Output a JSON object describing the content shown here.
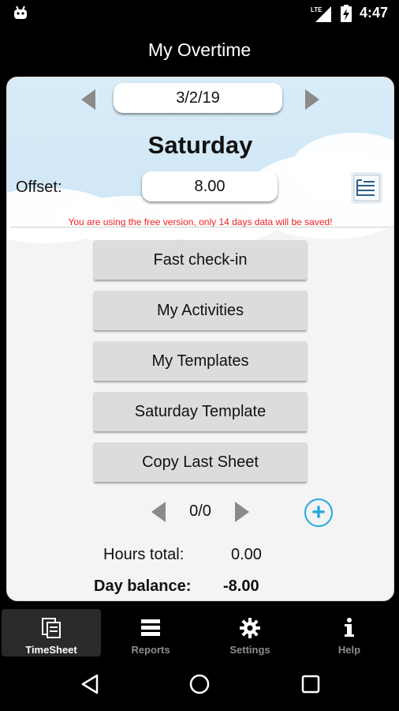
{
  "status_bar": {
    "time": "4:47",
    "network": "LTE"
  },
  "app_title": "My Overtime",
  "date": "3/2/19",
  "day_name": "Saturday",
  "offset": {
    "label": "Offset:",
    "value": "8.00"
  },
  "notice": "You are using the free version, only 14 days data will be saved!",
  "actions": [
    "Fast check-in",
    "My Activities",
    "My Templates",
    "Saturday Template",
    "Copy Last Sheet"
  ],
  "pager": {
    "text": "0/0"
  },
  "totals": {
    "hours_total_label": "Hours total:",
    "hours_total_value": "0.00",
    "day_balance_label": "Day balance:",
    "day_balance_value": "-8.00"
  },
  "bottom_nav": [
    {
      "label": "TimeSheet",
      "icon": "timesheet-icon",
      "active": true
    },
    {
      "label": "Reports",
      "icon": "reports-icon",
      "active": false
    },
    {
      "label": "Settings",
      "icon": "gear-icon",
      "active": false
    },
    {
      "label": "Help",
      "icon": "info-icon",
      "active": false
    }
  ],
  "colors": {
    "accent": "#21a8e0",
    "notice": "#ee2222",
    "button": "#dcdcdc"
  }
}
